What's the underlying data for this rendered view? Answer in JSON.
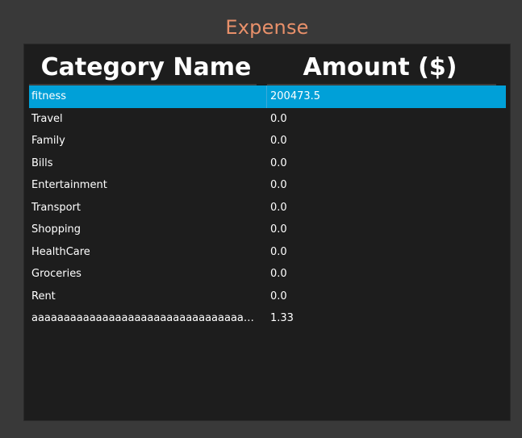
{
  "title": "Expense",
  "table": {
    "columns": [
      "Category Name",
      "Amount ($)"
    ],
    "rows": [
      {
        "name": "fitness",
        "amount": "200473.5",
        "selected": true
      },
      {
        "name": "Travel",
        "amount": "0.0"
      },
      {
        "name": "Family",
        "amount": "0.0"
      },
      {
        "name": "Bills",
        "amount": "0.0"
      },
      {
        "name": "Entertainment",
        "amount": "0.0"
      },
      {
        "name": "Transport",
        "amount": "0.0"
      },
      {
        "name": "Shopping",
        "amount": "0.0"
      },
      {
        "name": "HealthCare",
        "amount": "0.0"
      },
      {
        "name": "Groceries",
        "amount": "0.0"
      },
      {
        "name": "Rent",
        "amount": "0.0"
      },
      {
        "name": "aaaaaaaaaaaaaaaaaaaaaaaaaaaaaaaaaaaaaaaa...",
        "amount": "1.33"
      }
    ]
  },
  "colors": {
    "background": "#393939",
    "panel": "#1d1d1d",
    "title": "#e8906a",
    "selection": "#00a0d8",
    "text": "#ffffff"
  }
}
